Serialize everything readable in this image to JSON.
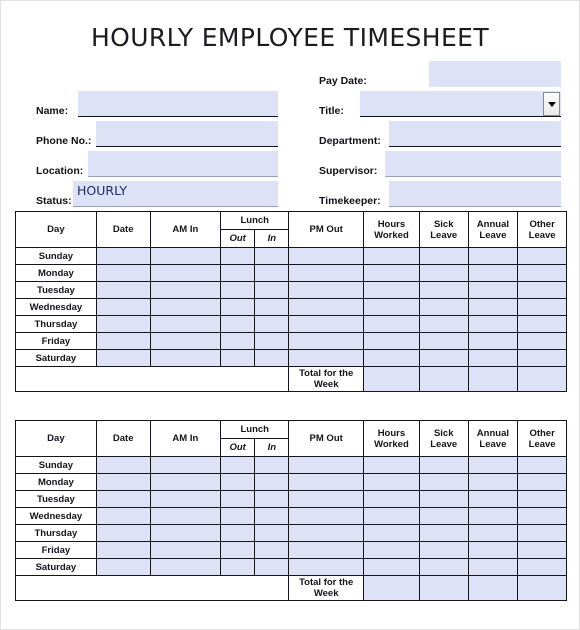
{
  "document": {
    "title": "HOURLY EMPLOYEE TIMESHEET"
  },
  "form": {
    "left_fields": [
      {
        "label": "Name:",
        "value": ""
      },
      {
        "label": "Phone No.:",
        "value": ""
      },
      {
        "label": "Location:",
        "value": ""
      },
      {
        "label": "Status:",
        "value": "HOURLY"
      }
    ],
    "right_fields": [
      {
        "label": "Pay Date:",
        "value": ""
      },
      {
        "label": "Title:",
        "value": ""
      },
      {
        "label": "Department:",
        "value": ""
      },
      {
        "label": "Supervisor:",
        "value": ""
      },
      {
        "label": "Timekeeper:",
        "value": ""
      }
    ]
  },
  "table": {
    "headers": {
      "day": "Day",
      "date": "Date",
      "am_in": "AM In",
      "lunch": "Lunch",
      "lunch_out": "Out",
      "lunch_in": "In",
      "pm_out": "PM Out",
      "hours_worked": "Hours Worked",
      "sick_leave": "Sick Leave",
      "annual_leave": "Annual Leave",
      "other_leave": "Other Leave"
    },
    "days": [
      "Sunday",
      "Monday",
      "Tuesday",
      "Wednesday",
      "Thursday",
      "Friday",
      "Saturday"
    ],
    "total_label": "Total for the Week"
  },
  "colors": {
    "input_fill": "#dde2f7",
    "border": "#14141c",
    "text": "#14141c",
    "value_text": "#1f2a63",
    "page_border": "#e2e2e2"
  }
}
